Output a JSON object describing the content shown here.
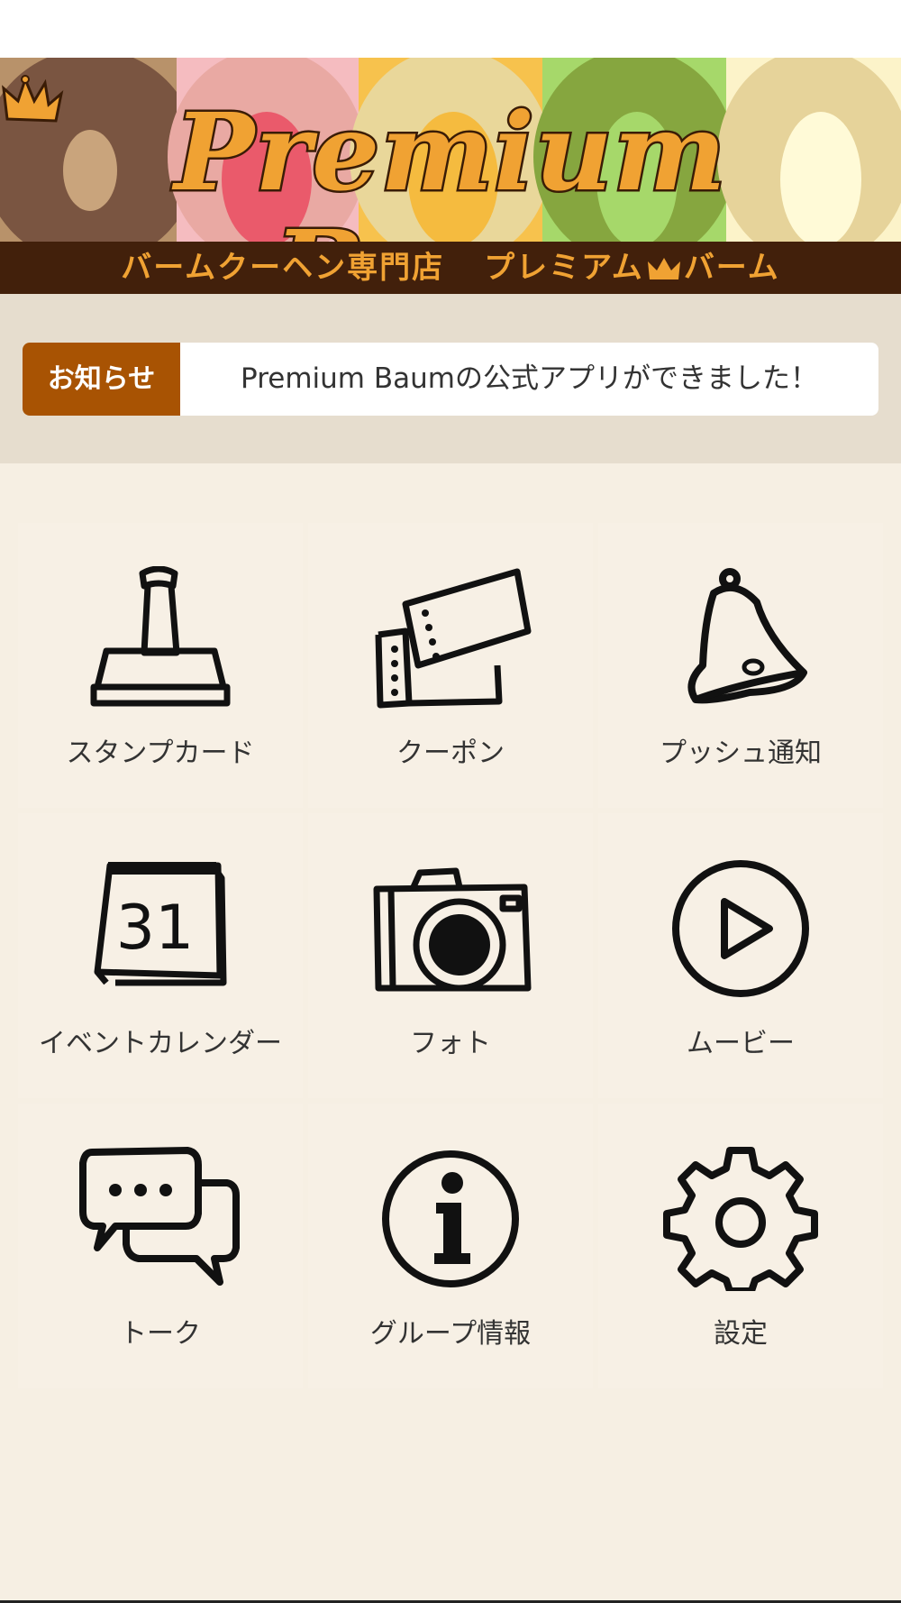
{
  "header": {
    "logo_text": "Premium Baum",
    "subtitle_left": "バームクーヘン専門店",
    "subtitle_right_a": "プレミアム",
    "subtitle_right_b": "バーム",
    "colors": {
      "logo": "#f0a233",
      "bar": "#42200b"
    }
  },
  "notice": {
    "label": "お知らせ",
    "text": "Premium Baumの公式アプリができました！",
    "label_color": "#a85303"
  },
  "menu": [
    {
      "label": "スタンプカード",
      "icon": "stamp-icon"
    },
    {
      "label": "クーポン",
      "icon": "coupon-icon"
    },
    {
      "label": "プッシュ通知",
      "icon": "bell-icon"
    },
    {
      "label": "イベントカレンダー",
      "icon": "calendar-icon",
      "icon_text": "31"
    },
    {
      "label": "フォト",
      "icon": "camera-icon"
    },
    {
      "label": "ムービー",
      "icon": "play-icon"
    },
    {
      "label": "トーク",
      "icon": "chat-icon"
    },
    {
      "label": "グループ情報",
      "icon": "info-icon"
    },
    {
      "label": "設定",
      "icon": "gear-icon"
    }
  ]
}
